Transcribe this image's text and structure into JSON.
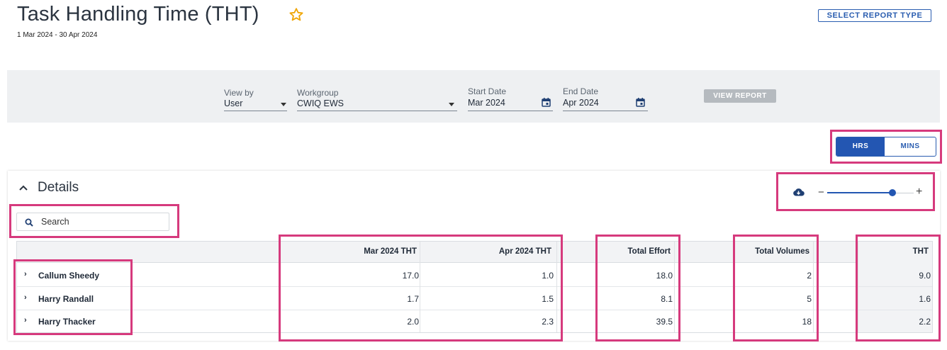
{
  "header": {
    "title": "Task Handling Time (THT)",
    "date_range": "1 Mar 2024 - 30 Apr 2024",
    "select_report_label": "SELECT REPORT TYPE",
    "favorite_icon": "star-outline-icon",
    "accent_color": "#f0a500"
  },
  "filters": {
    "view_by": {
      "label": "View by",
      "value": "User"
    },
    "workgroup": {
      "label": "Workgroup",
      "value": "CWIQ EWS"
    },
    "start_date": {
      "label": "Start Date",
      "value": "Mar 2024"
    },
    "end_date": {
      "label": "End Date",
      "value": "Apr 2024"
    },
    "view_report_label": "VIEW REPORT"
  },
  "unit_toggle": {
    "hrs": "HRS",
    "mins": "MINS",
    "selected": "HRS"
  },
  "details": {
    "title": "Details",
    "search_placeholder": "Search",
    "zoom_level": 0.75
  },
  "table": {
    "columns": [
      "Mar 2024 THT",
      "Apr 2024 THT",
      "Total Effort",
      "Total Volumes",
      "THT"
    ],
    "rows": [
      {
        "name": "Callum Sheedy",
        "mar": "17.0",
        "apr": "1.0",
        "effort": "18.0",
        "volumes": "2",
        "tht": "9.0"
      },
      {
        "name": "Harry Randall",
        "mar": "1.7",
        "apr": "1.5",
        "effort": "8.1",
        "volumes": "5",
        "tht": "1.6"
      },
      {
        "name": "Harry Thacker",
        "mar": "2.0",
        "apr": "2.3",
        "effort": "39.5",
        "volumes": "18",
        "tht": "2.2"
      }
    ]
  },
  "colors": {
    "primary": "#2356b2",
    "highlight": "#d63a7d",
    "filter_bg": "#eef0f2"
  }
}
